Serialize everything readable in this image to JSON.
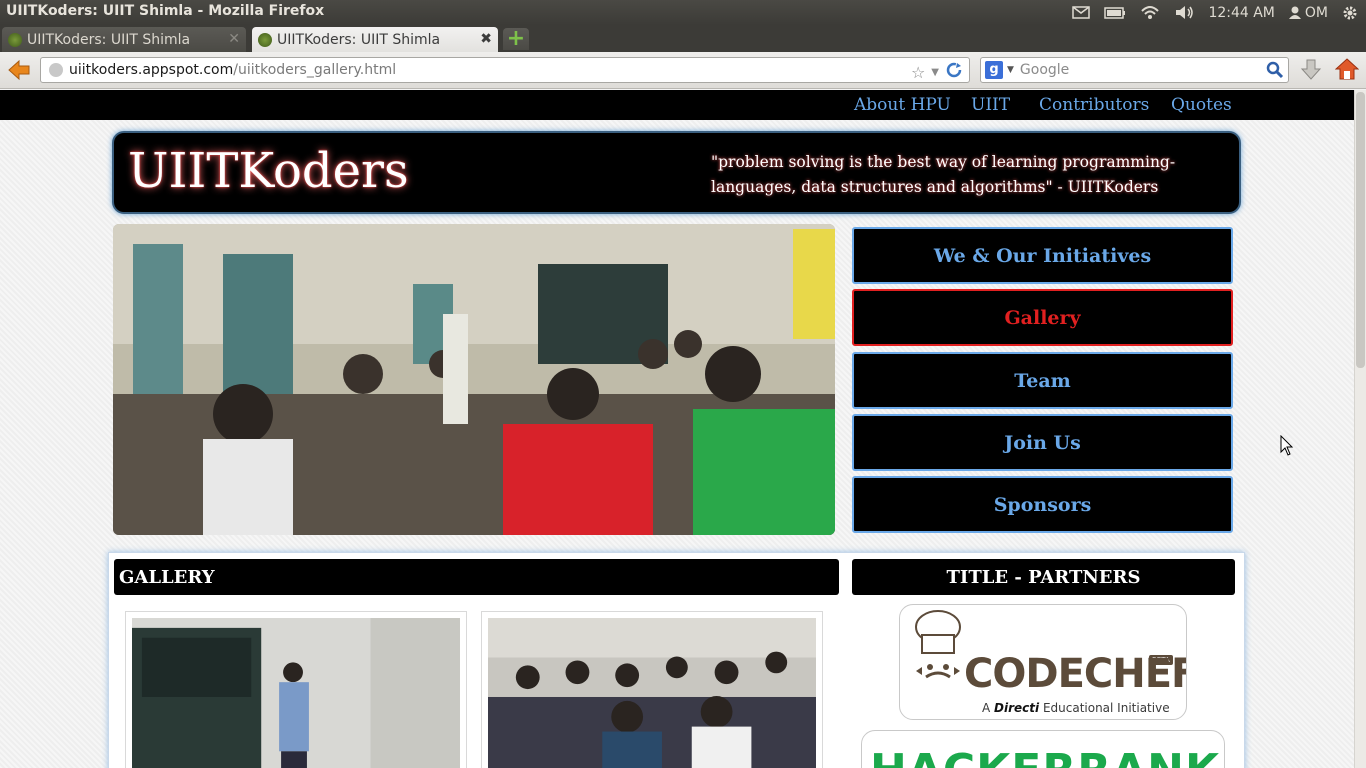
{
  "os": {
    "window_title": "UIITKoders: UIIT Shimla - Mozilla Firefox",
    "clock": "12:44 AM",
    "user": "OM"
  },
  "browser": {
    "tabs": [
      {
        "title": "UIITKoders: UIIT Shimla",
        "active": false
      },
      {
        "title": "UIITKoders: UIIT Shimla",
        "active": true
      }
    ],
    "url_host": "uiitkoders.appspot.com",
    "url_path": "/uiitkoders_gallery.html",
    "search_placeholder": "Google"
  },
  "page": {
    "topnav": [
      "About HPU",
      "UIIT",
      "Contributors",
      "Quotes"
    ],
    "site_title": "UIITKoders",
    "quote": "\"problem solving is the best way of learning programming-languages, data structures and algorithms\" - UIITKoders",
    "menu": [
      {
        "label": "We & Our Initiatives",
        "selected": false
      },
      {
        "label": "Gallery",
        "selected": true
      },
      {
        "label": "Team",
        "selected": false
      },
      {
        "label": "Join Us",
        "selected": false
      },
      {
        "label": "Sponsors",
        "selected": false
      }
    ],
    "gallery_heading": "GALLERY",
    "partners_heading": "TITLE - PARTNERS",
    "codechef": {
      "word": "CODECHEF",
      "beta": "BETA",
      "tagline_pre": "A ",
      "tagline_brand": "Directi",
      "tagline_post": " Educational Initiative"
    },
    "hackerrank_word": "HACKERRANK"
  },
  "colors": {
    "nav_link": "#6aa8e8",
    "selected_menu": "#e12020",
    "banner_bg": "#000000"
  }
}
